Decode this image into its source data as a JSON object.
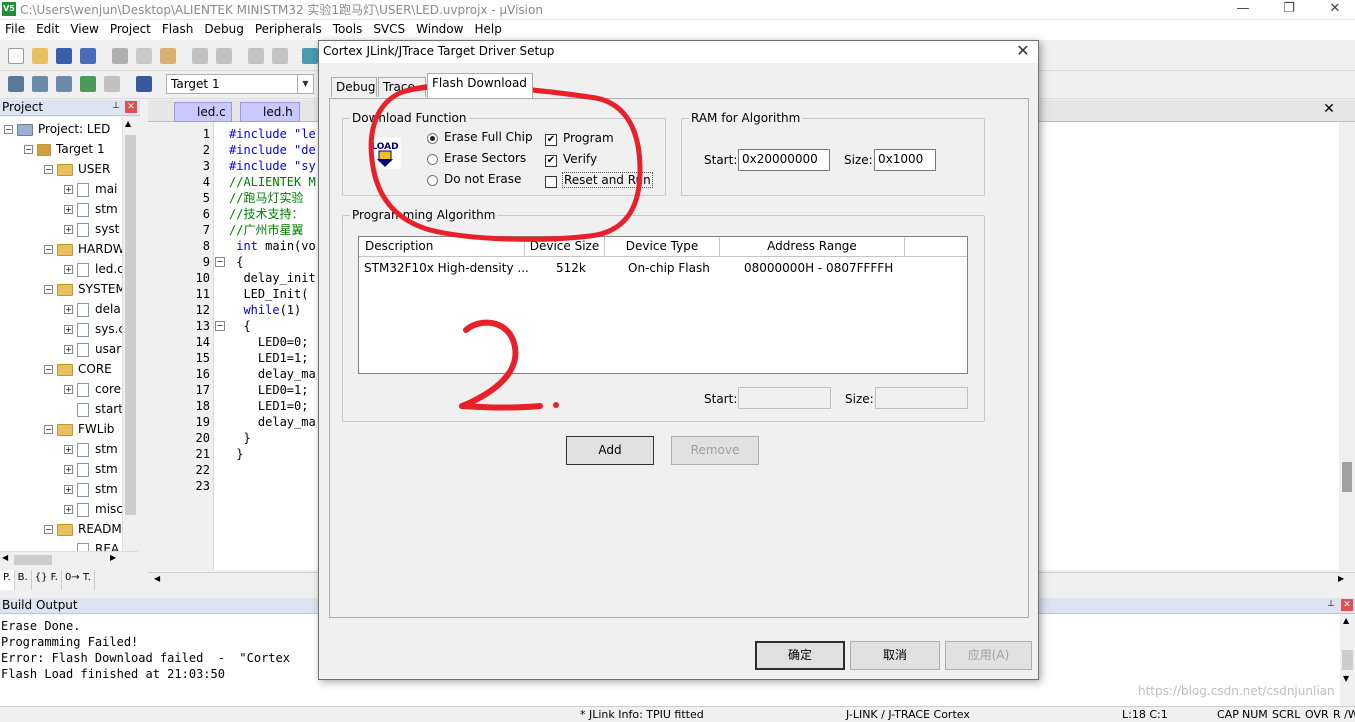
{
  "window": {
    "title": "C:\\Users\\wenjun\\Desktop\\ALIENTEK MINISTM32 实验1跑马灯\\USER\\LED.uvprojx - µVision",
    "app_icon": "V5"
  },
  "menu": [
    "File",
    "Edit",
    "View",
    "Project",
    "Flash",
    "Debug",
    "Peripherals",
    "Tools",
    "SVCS",
    "Window",
    "Help"
  ],
  "toolbar": {
    "target": "Target 1"
  },
  "project": {
    "header": "Project",
    "root": "Project: LED",
    "target": "Target 1",
    "groups": [
      {
        "name": "USER",
        "files": [
          "mai",
          "stm",
          "syst"
        ]
      },
      {
        "name": "HARDW",
        "files": [
          "led.c"
        ]
      },
      {
        "name": "SYSTEM",
        "files": [
          "dela",
          "sys.c",
          "usar"
        ]
      },
      {
        "name": "CORE",
        "files": [
          "core",
          "start"
        ]
      },
      {
        "name": "FWLib",
        "files": [
          "stm",
          "stm",
          "stm",
          "misc"
        ]
      },
      {
        "name": "READM",
        "files": [
          "REA"
        ]
      }
    ],
    "tabs": [
      "P.",
      "B.",
      "{} F.",
      "0→ T."
    ]
  },
  "editor": {
    "tabs": [
      "led.c",
      "led.h"
    ],
    "line_numbers": [
      "1",
      "2",
      "3",
      "4",
      "5",
      "6",
      "7",
      "8",
      "9",
      "10",
      "11",
      "12",
      "13",
      "14",
      "15",
      "16",
      "17",
      "18",
      "19",
      "20",
      "21",
      "22",
      "23"
    ],
    "lines": [
      "#include \"le",
      "#include \"de",
      "#include \"sy",
      "//ALIENTEK M",
      "//跑马灯实验",
      "//技术支持：",
      "//广州市星翼",
      " int main(vo",
      " {",
      "  delay_init",
      "  LED_Init(",
      "  while(1)",
      "  {",
      "    LED0=0;",
      "    LED1=1;",
      "    delay_ma",
      "    LED0=1;",
      "    LED1=0;",
      "    delay_ma",
      "  }",
      " }",
      "",
      ""
    ]
  },
  "build": {
    "header": "Build Output",
    "lines": [
      "Erase Done.",
      "Programming Failed!",
      "Error: Flash Download failed  -  \"Cortex",
      "Flash Load finished at 21:03:50"
    ]
  },
  "status": {
    "jlink_info": "* JLink Info: TPIU fitted",
    "debugger": "J-LINK / J-TRACE Cortex",
    "position": "L:18 C:1",
    "cap": "CAP",
    "num": "NUM",
    "scrl": "SCRL",
    "ovr": "OVR",
    "rw": "R /W"
  },
  "dialog": {
    "title": "Cortex JLink/JTrace Target Driver Setup",
    "tabs": [
      "Debug",
      "Trace",
      "Flash Download"
    ],
    "active_tab": "Flash Download",
    "download_function": {
      "title": "Download Function",
      "icon_label": "LOAD",
      "radios": [
        {
          "label": "Erase Full Chip",
          "checked": true
        },
        {
          "label": "Erase Sectors",
          "checked": false
        },
        {
          "label": "Do not Erase",
          "checked": false
        }
      ],
      "checks": [
        {
          "label": "Program",
          "checked": true
        },
        {
          "label": "Verify",
          "checked": true
        },
        {
          "label": "Reset and Run",
          "checked": false
        }
      ]
    },
    "ram": {
      "title": "RAM for Algorithm",
      "start_label": "Start:",
      "start_value": "0x20000000",
      "size_label": "Size:",
      "size_value": "0x1000"
    },
    "algorithm": {
      "title": "Programming Algorithm",
      "columns": [
        "Description",
        "Device Size",
        "Device Type",
        "Address Range"
      ],
      "rows": [
        [
          "STM32F10x High-density ...",
          "512k",
          "On-chip Flash",
          "08000000H - 0807FFFFH"
        ]
      ],
      "start_label": "Start:",
      "size_label": "Size:",
      "start_value": "",
      "size_value": ""
    },
    "buttons": {
      "add": "Add",
      "remove": "Remove",
      "ok": "确定",
      "cancel": "取消",
      "apply": "应用(A)"
    }
  },
  "annotation": {
    "text": "2.",
    "color": "#e8202a"
  },
  "watermark": "https://blog.csdn.net/csdnjunlian"
}
